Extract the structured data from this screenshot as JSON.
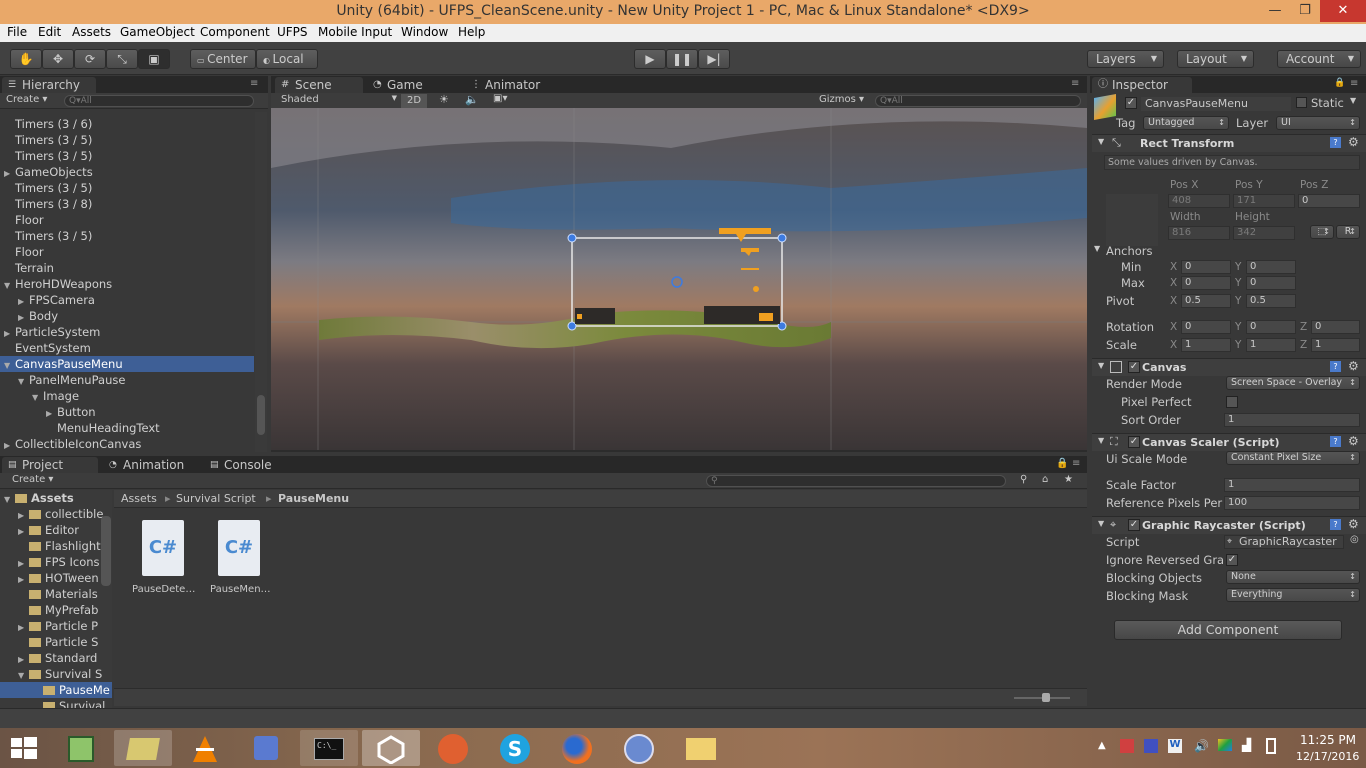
{
  "window": {
    "title": "Unity (64bit) - UFPS_CleanScene.unity - New Unity Project 1 - PC, Mac & Linux Standalone* <DX9>",
    "controls": {
      "minimize": "—",
      "maximize": "❐",
      "close": "✕"
    }
  },
  "menu": [
    "File",
    "Edit",
    "Assets",
    "GameObject",
    "Component",
    "UFPS",
    "Mobile Input",
    "Window",
    "Help"
  ],
  "toolbar": {
    "pivot_center": "Center",
    "pivot_local": "Local",
    "layers": "Layers",
    "layout": "Layout",
    "account": "Account"
  },
  "hierarchy": {
    "tab": "Hierarchy",
    "create": "Create",
    "search_placeholder": "Q▾All",
    "items": [
      {
        "label": "Timers (3 / 6)",
        "indent": 0,
        "arrow": ""
      },
      {
        "label": "Timers (3 / 5)",
        "indent": 0,
        "arrow": ""
      },
      {
        "label": "Timers (3 / 5)",
        "indent": 0,
        "arrow": ""
      },
      {
        "label": "GameObjects",
        "indent": 0,
        "arrow": "▶"
      },
      {
        "label": "Timers (3 / 5)",
        "indent": 0,
        "arrow": ""
      },
      {
        "label": "Timers (3 / 8)",
        "indent": 0,
        "arrow": ""
      },
      {
        "label": "Floor",
        "indent": 0,
        "arrow": ""
      },
      {
        "label": "Timers (3 / 5)",
        "indent": 0,
        "arrow": ""
      },
      {
        "label": "Floor",
        "indent": 0,
        "arrow": ""
      },
      {
        "label": "Terrain",
        "indent": 0,
        "arrow": ""
      },
      {
        "label": "HeroHDWeapons",
        "indent": 0,
        "arrow": "▼"
      },
      {
        "label": "FPSCamera",
        "indent": 1,
        "arrow": "▶"
      },
      {
        "label": "Body",
        "indent": 1,
        "arrow": "▶"
      },
      {
        "label": "ParticleSystem",
        "indent": 0,
        "arrow": "▶"
      },
      {
        "label": "EventSystem",
        "indent": 0,
        "arrow": ""
      },
      {
        "label": "CanvasPauseMenu",
        "indent": 0,
        "arrow": "▼",
        "selected": true
      },
      {
        "label": "PanelMenuPause",
        "indent": 1,
        "arrow": "▼"
      },
      {
        "label": "Image",
        "indent": 2,
        "arrow": "▼"
      },
      {
        "label": "Button",
        "indent": 3,
        "arrow": "▶"
      },
      {
        "label": "MenuHeadingText",
        "indent": 3,
        "arrow": ""
      },
      {
        "label": "CollectibleIconCanvas",
        "indent": 0,
        "arrow": "▶"
      }
    ]
  },
  "scene_tabs": {
    "scene": "Scene",
    "game": "Game",
    "animator": "Animator",
    "shading": "Shaded",
    "mode_2d": "2D",
    "gizmos": "Gizmos",
    "search_placeholder": "Q▾All"
  },
  "project": {
    "tabs": [
      "Project",
      "Animation",
      "Console"
    ],
    "create": "Create",
    "breadcrumb": [
      "Assets",
      "Survival Script",
      "PauseMenu"
    ],
    "folders": [
      {
        "label": "Assets",
        "indent": 0,
        "arrow": "▼"
      },
      {
        "label": "collectible",
        "indent": 1,
        "arrow": "▶"
      },
      {
        "label": "Editor",
        "indent": 1,
        "arrow": "▶"
      },
      {
        "label": "Flashlight",
        "indent": 1,
        "arrow": ""
      },
      {
        "label": "FPS Icons",
        "indent": 1,
        "arrow": "▶"
      },
      {
        "label": "HOTween",
        "indent": 1,
        "arrow": "▶"
      },
      {
        "label": "Materials",
        "indent": 1,
        "arrow": ""
      },
      {
        "label": "MyPrefab",
        "indent": 1,
        "arrow": ""
      },
      {
        "label": "Particle P",
        "indent": 1,
        "arrow": "▶"
      },
      {
        "label": "Particle S",
        "indent": 1,
        "arrow": ""
      },
      {
        "label": "Standard",
        "indent": 1,
        "arrow": "▶"
      },
      {
        "label": "Survival S",
        "indent": 1,
        "arrow": "▼"
      },
      {
        "label": "PauseMe",
        "indent": 2,
        "arrow": "",
        "selected": true
      },
      {
        "label": "Survival",
        "indent": 2,
        "arrow": ""
      }
    ],
    "assets": [
      {
        "label": "PauseDete…",
        "icon": "C#"
      },
      {
        "label": "PauseMen…",
        "icon": "C#"
      }
    ]
  },
  "inspector": {
    "tab": "Inspector",
    "object_name": "CanvasPauseMenu",
    "static_label": "Static",
    "tag_label": "Tag",
    "tag_value": "Untagged",
    "layer_label": "Layer",
    "layer_value": "UI",
    "rect_transform": {
      "title": "Rect Transform",
      "note": "Some values driven by Canvas.",
      "pos_x_label": "Pos X",
      "pos_y_label": "Pos Y",
      "pos_z_label": "Pos Z",
      "pos_x": "408",
      "pos_y": "171",
      "pos_z": "0",
      "width_label": "Width",
      "height_label": "Height",
      "width": "816",
      "height": "342",
      "r_button": "R",
      "anchors_label": "Anchors",
      "min_label": "Min",
      "max_label": "Max",
      "anchor_min_x": "0",
      "anchor_min_y": "0",
      "anchor_max_x": "0",
      "anchor_max_y": "0",
      "pivot_label": "Pivot",
      "pivot_x": "0.5",
      "pivot_y": "0.5",
      "rotation_label": "Rotation",
      "rot_x": "0",
      "rot_y": "0",
      "rot_z": "0",
      "scale_label": "Scale",
      "scale_x": "1",
      "scale_y": "1",
      "scale_z": "1",
      "x": "X",
      "y": "Y",
      "z": "Z"
    },
    "canvas": {
      "title": "Canvas",
      "render_mode_label": "Render Mode",
      "render_mode": "Screen Space - Overlay",
      "pixel_perfect_label": "Pixel Perfect",
      "sort_order_label": "Sort Order",
      "sort_order": "1"
    },
    "canvas_scaler": {
      "title": "Canvas Scaler (Script)",
      "ui_scale_label": "Ui Scale Mode",
      "ui_scale": "Constant Pixel Size",
      "scale_factor_label": "Scale Factor",
      "scale_factor": "1",
      "ref_ppu_label": "Reference Pixels Per",
      "ref_ppu": "100"
    },
    "raycaster": {
      "title": "Graphic Raycaster (Script)",
      "script_label": "Script",
      "script": "GraphicRaycaster",
      "ignore_label": "Ignore Reversed Gra",
      "blocking_objects_label": "Blocking Objects",
      "blocking_objects": "None",
      "blocking_mask_label": "Blocking Mask",
      "blocking_mask": "Everything"
    },
    "add_component": "Add Component"
  },
  "taskbar": {
    "time": "11:25 PM",
    "date": "12/17/2016"
  },
  "colors": {
    "titlebar": "#e9a869",
    "selection": "#3e5f96",
    "accent_orange": "#f0a020"
  }
}
